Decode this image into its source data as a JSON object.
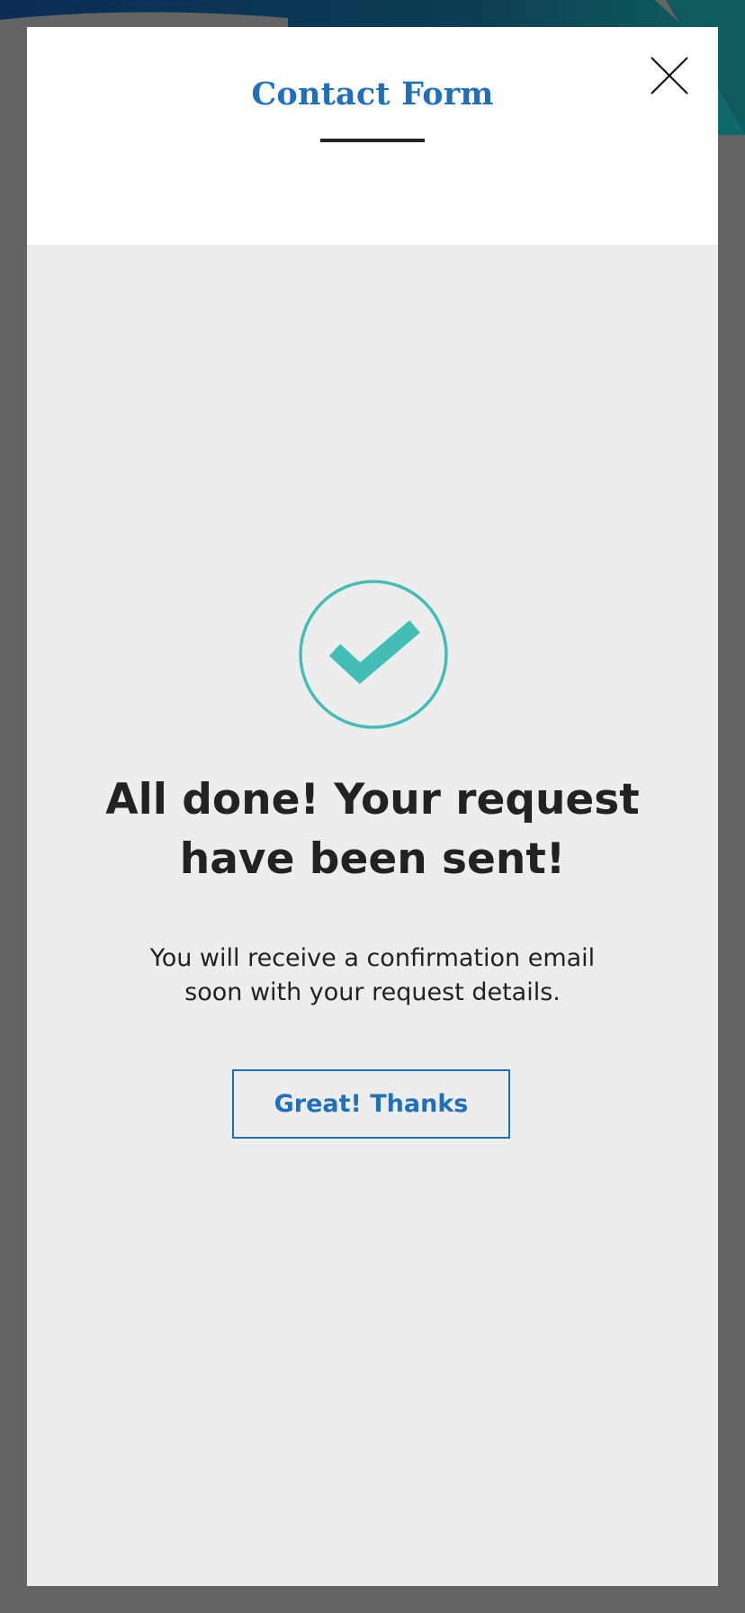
{
  "modal": {
    "title": "Contact Form",
    "close_icon": "close-icon",
    "success_icon": "checkmark-circle-icon",
    "heading": "All done! Your request have been sent!",
    "message": "You will receive a confirmation email soon with your request details.",
    "button_label": "Great! Thanks"
  },
  "colors": {
    "accent": "#1f6fba",
    "success": "#45bdb7",
    "overlay": "#646464",
    "panel": "#ededed"
  }
}
